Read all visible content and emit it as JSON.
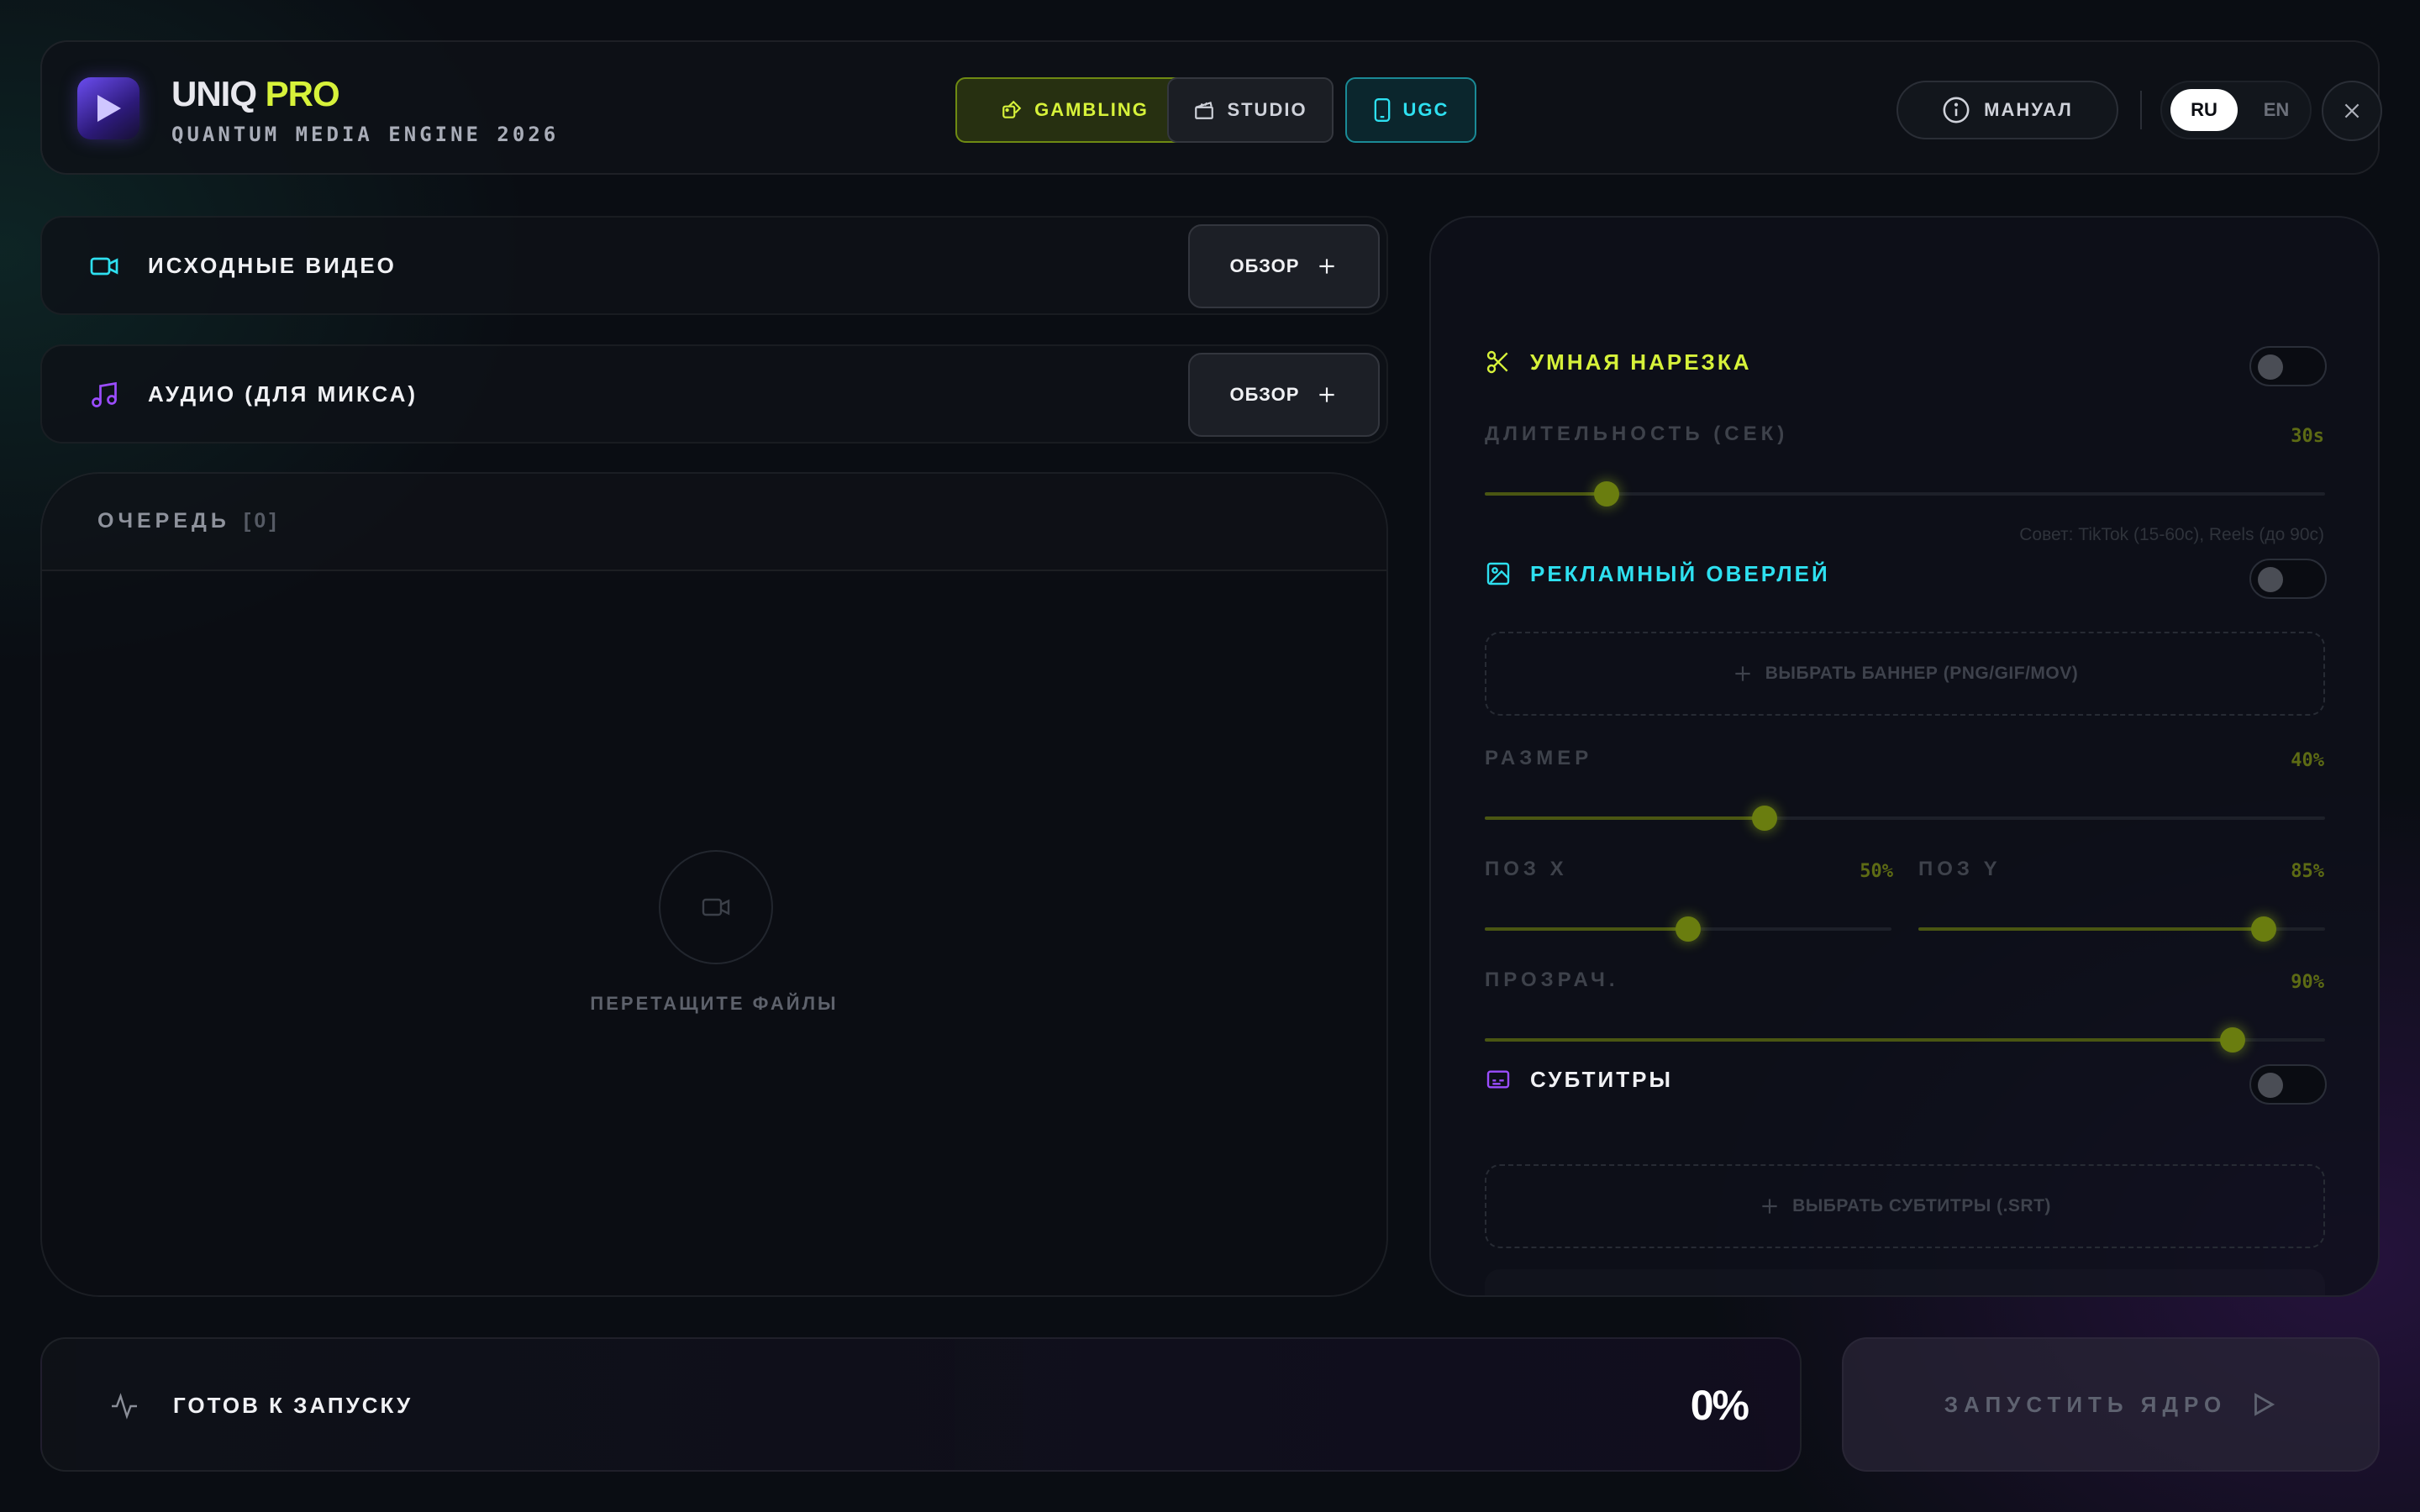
{
  "header": {
    "brand_main": "UNIQ",
    "brand_accent": "PRO",
    "subtitle": "QUANTUM MEDIA ENGINE 2026",
    "modes": [
      {
        "label": "GAMBLING",
        "icon": "dice-icon",
        "color": "#d7f23a"
      },
      {
        "label": "STUDIO",
        "icon": "clapperboard-icon",
        "color": "#cfd2da"
      },
      {
        "label": "UGC",
        "icon": "phone-icon",
        "color": "#2ee0f0"
      }
    ],
    "manual_label": "МАНУАЛ",
    "lang_ru": "RU",
    "lang_en": "EN"
  },
  "sources": {
    "video_label": "ИСХОДНЫЕ ВИДЕО",
    "audio_label": "АУДИО (ДЛЯ МИКСА)",
    "browse_label": "ОБЗОР"
  },
  "queue": {
    "title": "ОЧЕРЕДЬ",
    "count": "[0]",
    "drop_text": "ПЕРЕТАЩИТЕ ФАЙЛЫ"
  },
  "settings": {
    "smart_cut": {
      "title": "УМНАЯ НАРЕЗКА",
      "enabled": false,
      "duration_label": "ДЛИТЕЛЬНОСТЬ (СЕК)",
      "duration_value": "30s",
      "duration_fraction": 0.145,
      "tip": "Совет: TikTok (15-60с), Reels (до 90с)"
    },
    "overlay": {
      "title": "РЕКЛАМНЫЙ ОВЕРЛЕЙ",
      "enabled": false,
      "banner_button": "ВЫБРАТЬ БАННЕР (PNG/GIF/MOV)",
      "size_label": "РАЗМЕР",
      "size_value": "40%",
      "size_fraction": 0.333,
      "posx_label": "ПОЗ X",
      "posx_value": "50%",
      "posx_fraction": 0.5,
      "posy_label": "ПОЗ Y",
      "posy_value": "85%",
      "posy_fraction": 0.85,
      "opacity_label": "ПРОЗРАЧ.",
      "opacity_value": "90%",
      "opacity_fraction": 0.89
    },
    "subtitles": {
      "title": "СУБТИТРЫ",
      "enabled": false,
      "button": "ВЫБРАТЬ СУБТИТРЫ (.SRT)"
    }
  },
  "status": {
    "text": "ГОТОВ К ЗАПУСКУ",
    "percent": "0%"
  },
  "run_label": "ЗАПУСТИТЬ ЯДРО",
  "colors": {
    "accent_lime": "#d7f23a",
    "accent_cyan": "#2ee0f0",
    "accent_purple": "#9b4dff"
  }
}
